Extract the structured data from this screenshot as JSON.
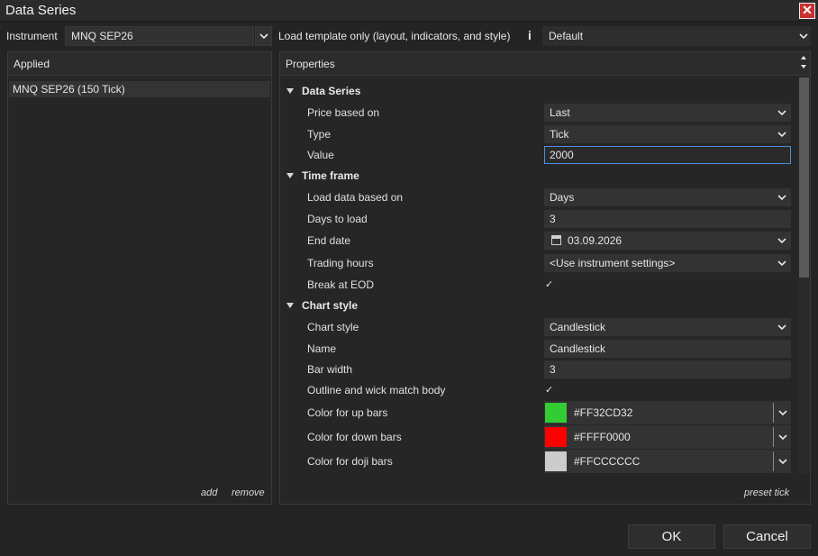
{
  "window": {
    "title": "Data Series"
  },
  "toolbar": {
    "instrument_label": "Instrument",
    "instrument_value": "MNQ SEP26",
    "template_label": "Load template only (layout, indicators, and style)",
    "template_value": "Default"
  },
  "applied": {
    "header": "Applied",
    "items": [
      "MNQ SEP26 (150 Tick)"
    ],
    "add_label": "add",
    "remove_label": "remove"
  },
  "properties": {
    "header": "Properties",
    "sections": [
      {
        "title": "Data Series"
      },
      {
        "title": "Time frame"
      },
      {
        "title": "Chart style"
      }
    ],
    "rows": [
      {
        "label": "Price based on",
        "value": "Last"
      },
      {
        "label": "Type",
        "value": "Tick"
      },
      {
        "label": "Value",
        "value": "2000"
      },
      {
        "label": "Load data based on",
        "value": "Days"
      },
      {
        "label": "Days to load",
        "value": "3"
      },
      {
        "label": "End date",
        "value": "03.09.2026"
      },
      {
        "label": "Trading hours",
        "value": "<Use instrument settings>"
      },
      {
        "label": "Break at EOD",
        "value": "✓"
      },
      {
        "label": "Chart style",
        "value": "Candlestick"
      },
      {
        "label": "Name",
        "value": "Candlestick"
      },
      {
        "label": "Bar width",
        "value": "3"
      },
      {
        "label": "Outline and wick match body",
        "value": "✓"
      },
      {
        "label": "Color for up bars",
        "value": "#FF32CD32",
        "swatch": "#32cd32"
      },
      {
        "label": "Color for down bars",
        "value": "#FFFF0000",
        "swatch": "#ff0000"
      },
      {
        "label": "Color for doji bars",
        "value": "#FFCCCCCC",
        "swatch": "#cccccc"
      }
    ],
    "preset_label": "preset tick"
  },
  "buttons": {
    "ok": "OK",
    "cancel": "Cancel"
  },
  "colors": {
    "background": "#242424",
    "focus": "#4a90d9",
    "close": "#c8312d"
  }
}
